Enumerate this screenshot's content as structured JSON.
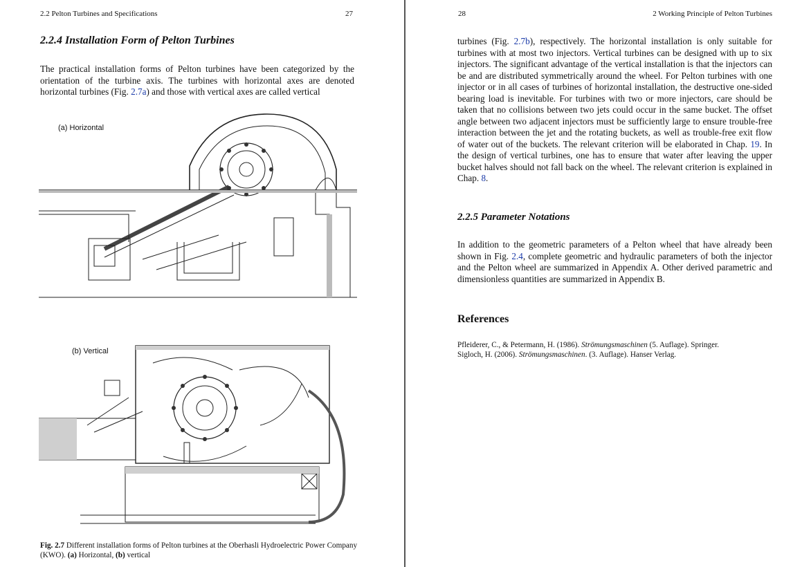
{
  "left_page": {
    "running_head": "2.2   Pelton Turbines and Specifications",
    "page_number": "27",
    "section_heading": "2.2.4   Installation Form of Pelton Turbines",
    "paragraph_text": "The practical installation forms of Pelton turbines have been categorized by the orientation of the turbine axis. The turbines with horizontal axes are denoted horizontal turbines (Fig. ",
    "paragraph_link_a": "2.7a",
    "paragraph_tail": ") and those with vertical axes are called vertical",
    "figure_label_a": "(a) Horizontal",
    "figure_label_b": "(b) Vertical",
    "caption_prefix": "Fig. 2.7",
    "caption_text": " Different installation forms of Pelton turbines at the Oberhasli Hydroelectric Power Company (KWO). ",
    "caption_a": "(a)",
    "caption_a_text": " Horizontal, ",
    "caption_b": "(b)",
    "caption_b_text": " vertical"
  },
  "right_page": {
    "page_number": "28",
    "running_head": "2   Working Principle of Pelton Turbines",
    "para1_start": "turbines (Fig. ",
    "para1_link_b": "2.7b",
    "para1_mid": "), respectively. The horizontal installation is only suitable for turbines with at most two injectors. Vertical turbines can be designed with up to six injectors. The significant advantage of the vertical installation is that the injectors can be and are distributed symmetrically around the wheel. For Pelton turbines with one injector or in all cases of turbines of horizontal installation, the destructive one-sided bearing load is inevitable. For turbines with two or more injectors, care should be taken that no collisions between two jets could occur in the same bucket. The offset angle between two adjacent injectors must be sufficiently large to ensure trouble-free interaction between the jet and the rotating buckets, as well as trouble-free exit flow of water out of the buckets. The relevant criterion will be elaborated in Chap. ",
    "para1_link_19": "19",
    "para1_mid2": ". In the design of vertical turbines, one has to ensure that water after leaving the upper bucket halves should not fall back on the wheel. The relevant criterion is explained in Chap. ",
    "para1_link_8": "8",
    "para1_end": ".",
    "section_heading": "2.2.5   Parameter Notations",
    "para2_start": "In addition to the geometric parameters of a Pelton wheel that have already been shown in Fig. ",
    "para2_link": "2.4",
    "para2_end": ", complete geometric and hydraulic parameters of both the injector and the Pelton wheel are summarized in Appendix A. Other derived parametric and dimensionless quantities are summarized in Appendix B.",
    "references_heading": "References",
    "references": [
      {
        "pre": "Pfleiderer, C., & Petermann, H. (1986). ",
        "title": "Strömungsmaschinen",
        "post": " (5. Auflage). Springer."
      },
      {
        "pre": "Sigloch, H. (2006). ",
        "title": "Strömungsmaschinen",
        "post": ". (3. Auflage). Hanser Verlag."
      }
    ]
  },
  "colors": {
    "link": "#1a3aa8",
    "gutter": "#555555"
  }
}
